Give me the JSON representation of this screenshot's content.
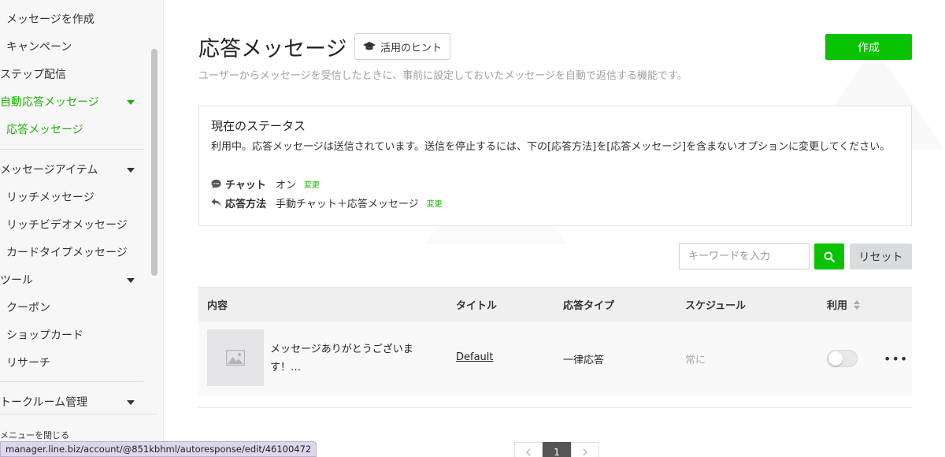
{
  "sidebar": {
    "items": [
      {
        "label": "メッセージを作成"
      },
      {
        "label": "キャンペーン"
      },
      {
        "label": "ステップ配信"
      },
      {
        "label": "自動応答メッセージ"
      },
      {
        "label": "応答メッセージ"
      },
      {
        "label": "メッセージアイテム"
      },
      {
        "label": "リッチメッセージ"
      },
      {
        "label": "リッチビデオメッセージ"
      },
      {
        "label": "カードタイプメッセージ"
      },
      {
        "label": "ツール"
      },
      {
        "label": "クーポン"
      },
      {
        "label": "ショップカード"
      },
      {
        "label": "リサーチ"
      },
      {
        "label": "トークルーム管理"
      }
    ],
    "close_menu_label": "メニューを閉じる"
  },
  "header": {
    "title": "応答メッセージ",
    "hint_button": "活用のヒント",
    "create_button": "作成",
    "subtitle": "ユーザーからメッセージを受信したときに、事前に設定しておいたメッセージを自動で返信する機能です。"
  },
  "status": {
    "heading": "現在のステータス",
    "description": "利用中。応答メッセージは送信されています。送信を停止するには、下の[応答方法]を[応答メッセージ]を含まないオプションに変更してください。",
    "chat_label": "チャット",
    "chat_value": "オン",
    "method_label": "応答方法",
    "method_value": "手動チャット＋応答メッセージ",
    "change_label": "変更"
  },
  "search": {
    "placeholder": "キーワードを入力",
    "reset_label": "リセット"
  },
  "table": {
    "headers": [
      "内容",
      "タイトル",
      "応答タイプ",
      "スケジュール",
      "利用"
    ],
    "rows": [
      {
        "content": "メッセージありがとうございます！…",
        "title": "Default",
        "type": "一律応答",
        "schedule": "常に",
        "enabled": false
      }
    ]
  },
  "pagination": {
    "current_page": "1"
  },
  "status_bar_url": "manager.line.biz/account/@851kbhml/autoresponse/edit/46100472",
  "colors": {
    "brand_green": "#09c300",
    "link_green": "#19b400"
  }
}
